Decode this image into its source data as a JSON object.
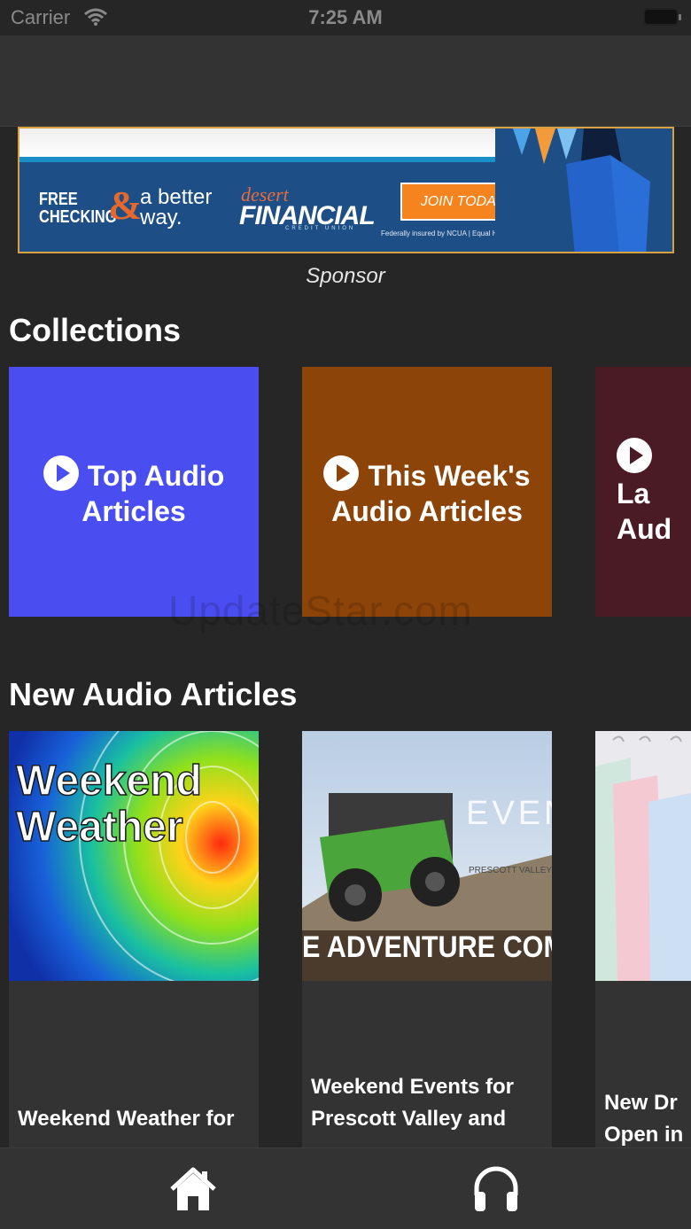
{
  "status": {
    "carrier": "Carrier",
    "time": "7:25 AM"
  },
  "ad": {
    "free_checking": "FREE\nCHECKING",
    "amp": "&",
    "tagline": "a better\nway.",
    "brand_top": "desert",
    "brand_main": "FINANCIAL",
    "brand_sub": "CREDIT UNION",
    "cta": "JOIN TODAY",
    "fineprint": "Federally insured by NCUA | Equal Housing Opportunity",
    "caption": "Sponsor"
  },
  "collections": {
    "title": "Collections",
    "items": [
      {
        "label": "Top Audio Articles",
        "color": "#4a4ef0"
      },
      {
        "label": "This Week's Audio Articles",
        "color": "#8c4409"
      },
      {
        "label": "La Aud",
        "color": "#4a1b24"
      }
    ]
  },
  "watermark": "UpdateStar.com",
  "new_articles": {
    "title": "New Audio Articles",
    "items": [
      {
        "image_text": "Weekend Weather",
        "title": "Weekend Weather for"
      },
      {
        "image_text": "EVEN THIS WE",
        "image_sub": "PRESCOTT VALLEY CHINO VALLEY",
        "image_banner": "E ADVENTURE COMES TOG",
        "title": "Weekend Events for Prescott Valley and"
      },
      {
        "title": "New Dr Open in"
      }
    ]
  },
  "tabs": [
    {
      "icon": "home-icon"
    },
    {
      "icon": "headphones-icon"
    }
  ]
}
